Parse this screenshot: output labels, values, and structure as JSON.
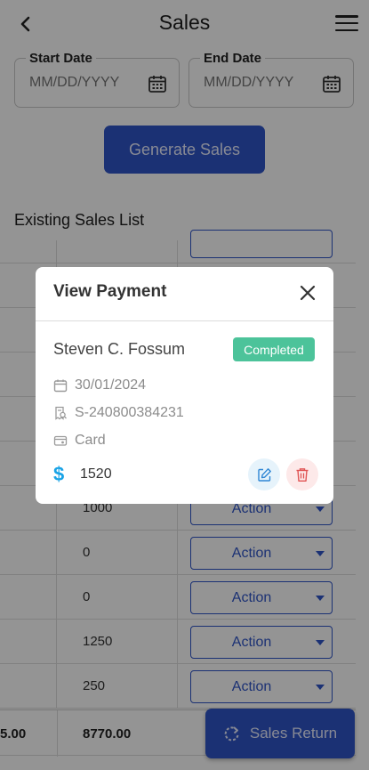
{
  "header": {
    "title": "Sales"
  },
  "filters": {
    "start_label": "Start Date",
    "start_placeholder": "MM/DD/YYYY",
    "end_label": "End Date",
    "end_placeholder": "MM/DD/YYYY",
    "generate_label": "Generate Sales"
  },
  "list": {
    "title": "Existing Sales List",
    "rows": [
      {
        "amount": "",
        "action": ""
      },
      {
        "amount": "",
        "action": ""
      },
      {
        "amount": "",
        "action": ""
      },
      {
        "amount": "",
        "action": ""
      },
      {
        "amount": "",
        "action": ""
      },
      {
        "amount": "1000",
        "action": "Action"
      },
      {
        "amount": "0",
        "action": "Action"
      },
      {
        "amount": "0",
        "action": "Action"
      },
      {
        "amount": "1250",
        "action": "Action"
      },
      {
        "amount": "250",
        "action": "Action"
      }
    ],
    "total_left": "5.00",
    "total_amount": "8770.00"
  },
  "fab": {
    "label": "Sales Return"
  },
  "modal": {
    "title": "View Payment",
    "customer": "Steven C. Fossum",
    "status": "Completed",
    "date": "30/01/2024",
    "invoice": "S-240800384231",
    "method": "Card",
    "amount": "1520"
  },
  "colors": {
    "primary": "#2f55c8",
    "badge": "#4cc39a",
    "dollar": "#19a3e6",
    "danger": "#e05454"
  },
  "icons": [
    "back-arrow-icon",
    "hamburger-menu-icon",
    "calendar-icon",
    "close-icon",
    "receipt-icon",
    "card-icon",
    "dollar-icon",
    "edit-icon",
    "trash-icon",
    "refresh-icon"
  ]
}
